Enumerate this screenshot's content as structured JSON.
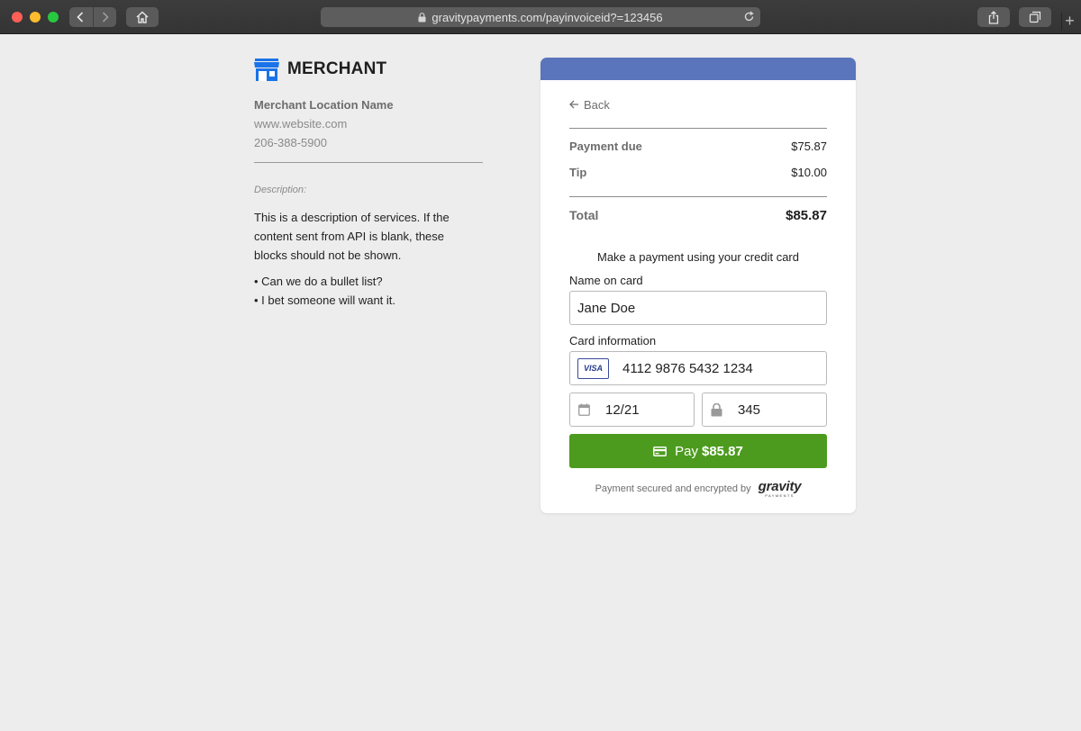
{
  "browser": {
    "url": "gravitypayments.com/payinvoiceid?=123456",
    "new_tab_label": "+"
  },
  "merchant": {
    "brand_name": "MERCHANT",
    "location_name": "Merchant Location Name",
    "website": "www.website.com",
    "phone": "206-388-5900",
    "description_label": "Description:",
    "description_text": "This is a description of services. If the content sent from API is blank, these blocks should not be shown.",
    "bullets": [
      "• Can we do a bullet list?",
      "• I bet someone will want it."
    ],
    "brand_color": "#1a73e8"
  },
  "payment": {
    "header_color": "#5a75bb",
    "back_label": "Back",
    "due_label": "Payment due",
    "due_value": "$75.87",
    "tip_label": "Tip",
    "tip_value": "$10.00",
    "total_label": "Total",
    "total_value": "$85.87",
    "prompt": "Make a payment using your credit card",
    "name_label": "Name on card",
    "name_value": "Jane Doe",
    "card_label": "Card information",
    "card_brand": "VISA",
    "card_number": "4112 9876 5432 1234",
    "expiry": "12/21",
    "cvc": "345",
    "pay_label": "Pay",
    "pay_amount": "$85.87",
    "pay_color": "#4c9b1e",
    "secure_text": "Payment secured and encrypted by",
    "gravity_word": "gravity",
    "gravity_sub": "PAYMENTS"
  }
}
